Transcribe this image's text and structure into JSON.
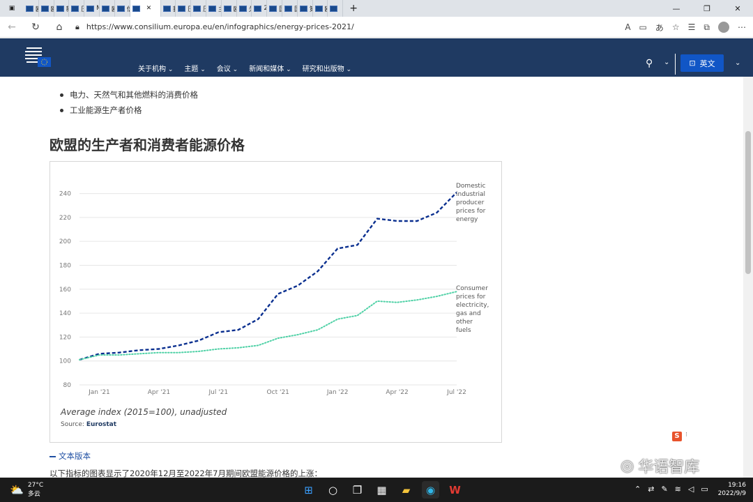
{
  "browser": {
    "tabs": [
      {
        "label": "欧洲"
      },
      {
        "label": "欧盟"
      },
      {
        "label": "新闻"
      },
      {
        "label": "压缩"
      },
      {
        "label": "Me"
      },
      {
        "label": "欧盟"
      },
      {
        "label": "信息"
      },
      {
        "label": ""
      },
      {
        "label": "我们"
      },
      {
        "label": "压缩"
      },
      {
        "label": "压缩"
      },
      {
        "label": "主席"
      },
      {
        "label": "欧盟"
      },
      {
        "label": "关于"
      },
      {
        "label": "205"
      },
      {
        "label": "国家"
      },
      {
        "label": "国家"
      },
      {
        "label": "第8"
      },
      {
        "label": "欧元"
      },
      {
        "label": "《E"
      }
    ],
    "new_tab": "+",
    "url": "https://www.consilium.europa.eu/en/infographics/energy-prices-2021/"
  },
  "site": {
    "menu": [
      "关于机构",
      "主题",
      "会议",
      "新闻和媒体",
      "研究和出版物"
    ],
    "language_label": "英文"
  },
  "content": {
    "bullets": [
      "电力、天然气和其他燃料的消费价格",
      "工业能源生产者价格"
    ],
    "heading": "欧盟的生产者和消费者能源价格",
    "caption": "Average index (2015=100), unadjusted",
    "source_prefix": "Source:",
    "source_name": "Eurostat",
    "text_version": "文本版本",
    "paragraph": "以下指标的图表显示了2020年12月至2022年7月期间欧盟能源价格的上涨："
  },
  "chart_data": {
    "type": "line",
    "x": [
      "Dec '20",
      "Jan '21",
      "Feb '21",
      "Mar '21",
      "Apr '21",
      "May '21",
      "Jun '21",
      "Jul '21",
      "Aug '21",
      "Sep '21",
      "Oct '21",
      "Nov '21",
      "Dec '21",
      "Jan '22",
      "Feb '22",
      "Mar '22",
      "Apr '22",
      "May '22",
      "Jun '22",
      "Jul '22"
    ],
    "xticks": [
      "Jan '21",
      "Apr '21",
      "Jul '21",
      "Oct '21",
      "Jan '22",
      "Apr '22",
      "Jul '22"
    ],
    "yticks": [
      80,
      100,
      120,
      140,
      160,
      180,
      200,
      220,
      240
    ],
    "ylim": [
      80,
      245
    ],
    "series": [
      {
        "name": "Domestic industrial producer prices for energy",
        "color": "#0a2f8f",
        "style": "dashed",
        "values": [
          101,
          106,
          107,
          109,
          110,
          113,
          117,
          124,
          126,
          135,
          156,
          163,
          175,
          194,
          197,
          219,
          217,
          217,
          224,
          241
        ]
      },
      {
        "name": "Consumer prices for electricity, gas and other fuels",
        "color": "#4fd1a6",
        "style": "dotted",
        "values": [
          101,
          105,
          105,
          106,
          107,
          107,
          108,
          110,
          111,
          113,
          119,
          122,
          126,
          135,
          138,
          150,
          149,
          151,
          154,
          158
        ]
      }
    ],
    "labels_lines": [
      [
        "Domestic",
        "industrial",
        "producer",
        "prices for",
        "energy"
      ],
      [
        "Consumer",
        "prices for",
        "electricity,",
        "gas and",
        "other",
        "fuels"
      ]
    ],
    "grid": true
  },
  "taskbar": {
    "temperature": "27°C",
    "weather": "多云",
    "time": "19:16",
    "date": "2022/9/9"
  },
  "watermark": "华语智库"
}
